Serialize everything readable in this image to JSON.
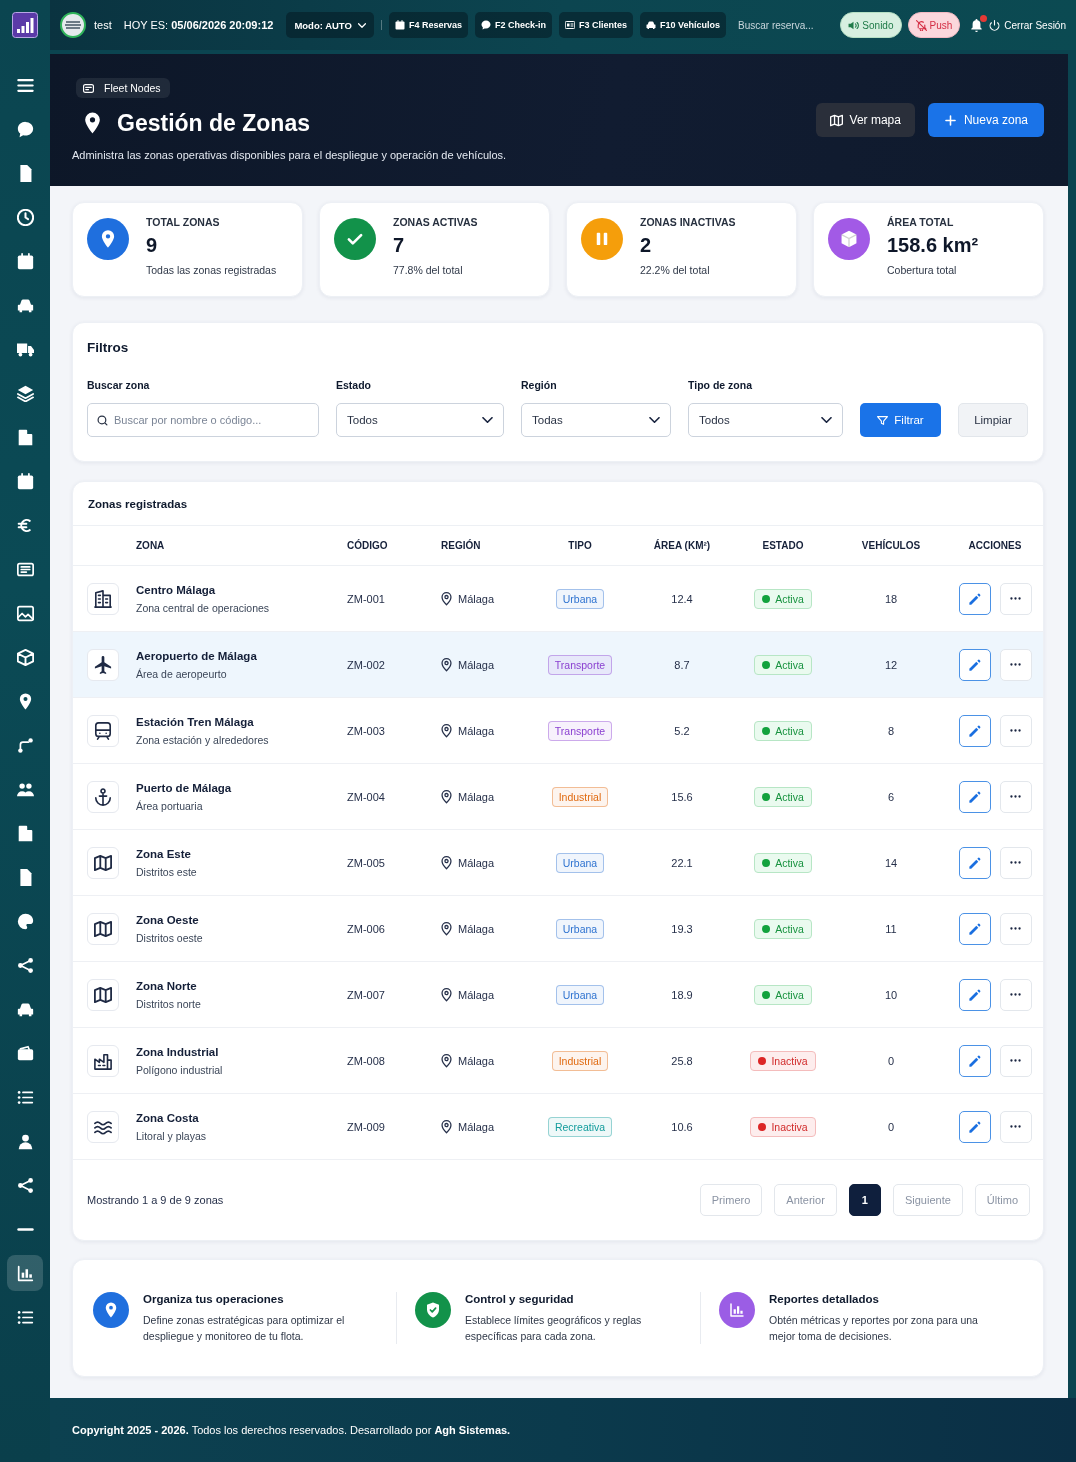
{
  "sidebar": {
    "items": [
      {
        "selected": false
      },
      {
        "selected": false
      },
      {
        "selected": false
      },
      {
        "selected": false
      },
      {
        "selected": false
      },
      {
        "selected": false
      },
      {
        "selected": false
      },
      {
        "selected": false
      },
      {
        "selected": false
      },
      {
        "selected": false
      },
      {
        "selected": false
      },
      {
        "selected": false
      },
      {
        "selected": false
      },
      {
        "selected": false
      },
      {
        "selected": false
      },
      {
        "selected": false
      },
      {
        "selected": false
      },
      {
        "selected": false
      },
      {
        "selected": false
      },
      {
        "selected": false
      },
      {
        "selected": false
      },
      {
        "selected": false
      },
      {
        "selected": false
      },
      {
        "selected": false
      },
      {
        "selected": false
      },
      {
        "selected": false
      },
      {
        "selected": false
      },
      {
        "selected": true
      },
      {
        "selected": false
      }
    ]
  },
  "topbar": {
    "user": "test",
    "date": "HOY ES: **05/06/2026 20:09:12**",
    "mode": "Modo: AUTO",
    "shortcuts": [
      {
        "kind": "reservations",
        "label": "F4 Reservas"
      },
      {
        "kind": "checkin",
        "label": "F2 Check-in"
      },
      {
        "kind": "clients",
        "label": "F3 Clientes"
      },
      {
        "kind": "vehicles",
        "label": "F10 Vehículos"
      }
    ],
    "search": {
      "placeholder": "Buscar reserva..."
    },
    "toggles": [
      {
        "kind": "sound",
        "label": "Sonido",
        "on": true
      },
      {
        "kind": "push",
        "label": "Push",
        "on": false
      }
    ],
    "logout": "Cerrar Sesión"
  },
  "header": {
    "breadcrumb": "Fleet Nodes",
    "title": "Gestión de Zonas",
    "subtitle": "Administra las zonas operativas disponibles para el despliegue y operación de vehículos.",
    "actions": [
      {
        "kind": "secondary",
        "label": "Ver mapa"
      },
      {
        "kind": "primary",
        "label": "Nueva zona"
      }
    ]
  },
  "stats": [
    {
      "kind": "total",
      "color": "#1f6fde",
      "label": "TOTAL ZONAS",
      "value": "9",
      "note": "Todas las zonas registradas"
    },
    {
      "kind": "active",
      "color": "#12924a",
      "label": "ZONAS ACTIVAS",
      "value": "7",
      "note": "77.8% del total"
    },
    {
      "kind": "inactive",
      "color": "#f59e0b",
      "label": "ZONAS INACTIVAS",
      "value": "2",
      "note": "22.2% del total"
    },
    {
      "kind": "area",
      "color": "#a25ae6",
      "label": "ÁREA TOTAL",
      "value": "158.6 km²",
      "note": "Cobertura total"
    }
  ],
  "filters": {
    "title": "Filtros",
    "fields": [
      {
        "kind": "search",
        "label": "Buscar zona",
        "placeholder": "Buscar por nombre o código..."
      },
      {
        "kind": "select",
        "label": "Estado",
        "value": "Todos"
      },
      {
        "kind": "select",
        "label": "Región",
        "value": "Todas"
      },
      {
        "kind": "select",
        "label": "Tipo de zona",
        "value": "Todos"
      }
    ],
    "buttons": [
      {
        "kind": "primary",
        "label": "Filtrar"
      },
      {
        "kind": "secondary",
        "label": "Limpiar"
      }
    ]
  },
  "table": {
    "title": "Zonas registradas",
    "columns": [
      "ZONA",
      "CÓDIGO",
      "REGIÓN",
      "TIPO",
      "ÁREA (KM²)",
      "ESTADO",
      "VEHÍCULOS",
      "ACCIONES"
    ],
    "rows": [
      {
        "kind": "city",
        "name": "Centro Málaga",
        "description": "Zona central de operaciones",
        "code": "ZM-001",
        "region": "Málaga",
        "type": {
          "label": "Urbana",
          "color": "#2f73d0"
        },
        "area": "12.4",
        "status": {
          "label": "Activa",
          "active": true
        },
        "vehicles": "18",
        "selected": false
      },
      {
        "kind": "airport",
        "name": "Aeropuerto de Málaga",
        "description": "Área de aeropeurto",
        "code": "ZM-002",
        "region": "Málaga",
        "type": {
          "label": "Transporte",
          "color": "#8a3fd0"
        },
        "area": "8.7",
        "status": {
          "label": "Activa",
          "active": true
        },
        "vehicles": "12",
        "selected": true
      },
      {
        "kind": "station",
        "name": "Estación Tren Málaga",
        "description": "Zona estación y alrededores",
        "code": "ZM-003",
        "region": "Málaga",
        "type": {
          "label": "Transporte",
          "color": "#8a3fd0"
        },
        "area": "5.2",
        "status": {
          "label": "Activa",
          "active": true
        },
        "vehicles": "8",
        "selected": false
      },
      {
        "kind": "port",
        "name": "Puerto de Málaga",
        "description": "Área portuaria",
        "code": "ZM-004",
        "region": "Málaga",
        "type": {
          "label": "Industrial",
          "color": "#e06a10"
        },
        "area": "15.6",
        "status": {
          "label": "Activa",
          "active": true
        },
        "vehicles": "6",
        "selected": false
      },
      {
        "kind": "district",
        "name": "Zona Este",
        "description": "Distritos este",
        "code": "ZM-005",
        "region": "Málaga",
        "type": {
          "label": "Urbana",
          "color": "#2f73d0"
        },
        "area": "22.1",
        "status": {
          "label": "Activa",
          "active": true
        },
        "vehicles": "14",
        "selected": false
      },
      {
        "kind": "district",
        "name": "Zona Oeste",
        "description": "Distritos oeste",
        "code": "ZM-006",
        "region": "Málaga",
        "type": {
          "label": "Urbana",
          "color": "#2f73d0"
        },
        "area": "19.3",
        "status": {
          "label": "Activa",
          "active": true
        },
        "vehicles": "11",
        "selected": false
      },
      {
        "kind": "district",
        "name": "Zona Norte",
        "description": "Distritos norte",
        "code": "ZM-007",
        "region": "Málaga",
        "type": {
          "label": "Urbana",
          "color": "#2f73d0"
        },
        "area": "18.9",
        "status": {
          "label": "Activa",
          "active": true
        },
        "vehicles": "10",
        "selected": false
      },
      {
        "kind": "industrial",
        "name": "Zona Industrial",
        "description": "Polígono industrial",
        "code": "ZM-008",
        "region": "Málaga",
        "type": {
          "label": "Industrial",
          "color": "#e06a10"
        },
        "area": "25.8",
        "status": {
          "label": "Inactiva",
          "active": false
        },
        "vehicles": "0",
        "selected": false
      },
      {
        "kind": "coast",
        "name": "Zona Costa",
        "description": "Litoral y playas",
        "code": "ZM-009",
        "region": "Málaga",
        "type": {
          "label": "Recreativa",
          "color": "#129c9c"
        },
        "area": "10.6",
        "status": {
          "label": "Inactiva",
          "active": false
        },
        "vehicles": "0",
        "selected": false
      }
    ],
    "pagination": {
      "summary": "Mostrando 1 a 9 de 9 zonas",
      "pages": [
        {
          "label": "Primero",
          "selected": false
        },
        {
          "label": "Anterior",
          "selected": false
        },
        {
          "label": "1",
          "selected": true
        },
        {
          "label": "Siguiente",
          "selected": false
        },
        {
          "label": "Último",
          "selected": false
        }
      ]
    }
  },
  "highlights": [
    {
      "kind": "operations",
      "color": "#1f6fde",
      "title": "Organiza tus operaciones",
      "text": "Define zonas estratégicas para optimizar el despliegue y monitoreo de tu flota."
    },
    {
      "kind": "security",
      "color": "#12924a",
      "title": "Control y seguridad",
      "text": "Establece límites geográficos y reglas específicas para cada zona."
    },
    {
      "kind": "reports",
      "color": "#9b5de5",
      "title": "Reportes detallados",
      "text": "Obtén métricas y reportes por zona para una mejor toma de decisiones."
    }
  ],
  "footer": {
    "text": "**Copyright 2025 - 2026.** Todos los derechos reservados. Desarrollado por **Agh Sistemas.**"
  }
}
